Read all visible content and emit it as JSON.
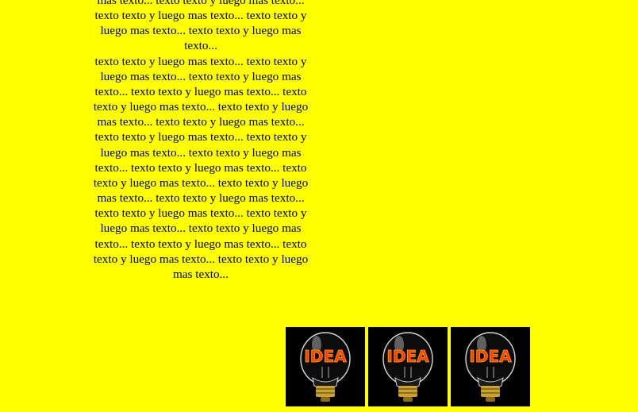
{
  "content": {
    "paragraph_top": "mas texto... texto texto y luego mas texto... texto texto y luego mas texto... texto texto y luego mas texto... texto texto y luego mas texto...",
    "paragraph_main": "texto texto y luego mas texto... texto texto y luego mas texto... texto texto y luego mas texto... texto texto y luego mas texto... texto texto y luego mas texto... texto texto y luego mas texto... texto texto y luego mas texto... texto texto y luego mas texto... texto texto y luego mas texto... texto texto y luego mas texto... texto texto y luego mas texto... texto texto y luego mas texto... texto texto y luego mas texto... texto texto y luego mas texto... texto texto y luego mas texto... texto texto y luego mas texto... texto texto y luego mas texto... texto texto y luego mas texto... texto texto y luego mas texto... texto texto y luego mas texto..."
  },
  "images": [
    {
      "name": "idea-lightbulb-image",
      "label": "IDEA"
    },
    {
      "name": "idea-lightbulb-image",
      "label": "IDEA"
    },
    {
      "name": "idea-lightbulb-image",
      "label": "IDEA"
    }
  ],
  "colors": {
    "background": "#ffff00",
    "text": "#000000",
    "filament": "#ff5a00"
  }
}
